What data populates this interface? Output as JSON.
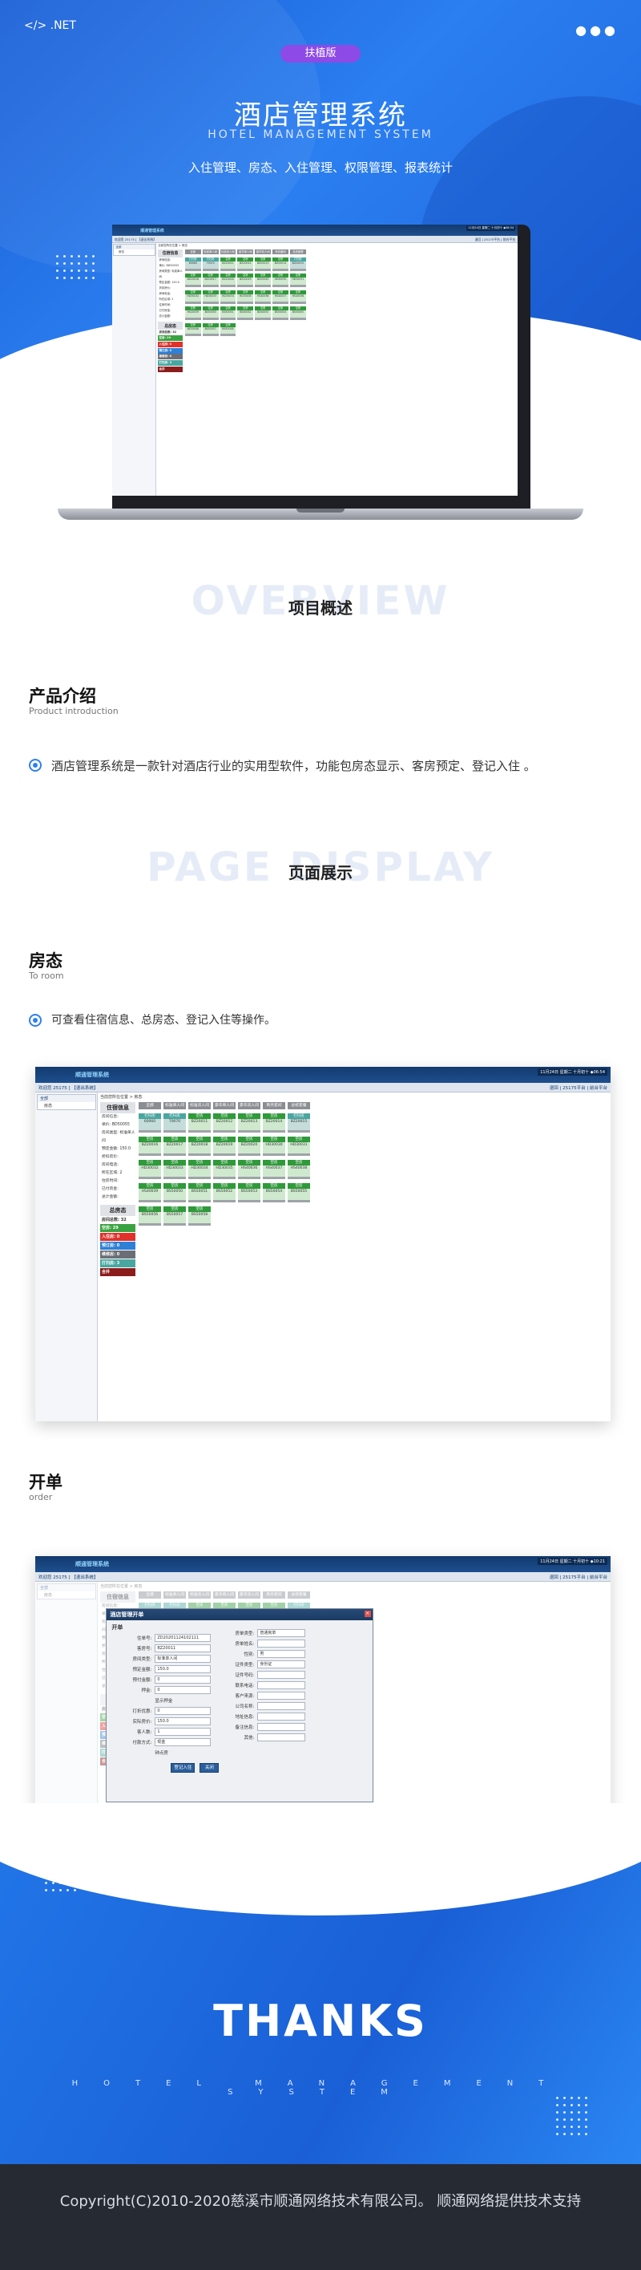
{
  "hero": {
    "logo": "</> .NET",
    "edition_badge": "扶植版",
    "title": "酒店管理系统",
    "subtitle": "HOTEL MANAGEMENT SYSTEM",
    "features": "入住管理、房态、入住管理、权限管理、报表统计"
  },
  "overview": {
    "ghost": "OVERVIEW",
    "title": "项目概述"
  },
  "intro": {
    "title": "产品介绍",
    "subtitle": "Product introduction",
    "text": "酒店管理系统是一款针对酒店行业的实用型软件，功能包房态显示、客房预定、登记入住 。"
  },
  "display": {
    "ghost": "PAGE DISPLAY",
    "title": "页面展示"
  },
  "room_status": {
    "title": "房态",
    "subtitle": "To room",
    "text": "可查看住宿信息、总房态、登记入住等操作。"
  },
  "order": {
    "title": "开单",
    "subtitle": "order"
  },
  "app": {
    "logo": "顺通管理系统",
    "clock": "11月24日 星期二 十月初十 ◆06:54",
    "clock2": "11月24日 星期二 十月初十 ◆10:21",
    "welcome": "欢迎您 25175 [ 【退出系统】",
    "links": "退回 | 25175平台 | 前台平台",
    "tree_head": "全部",
    "tree_item": "房态",
    "crumb": "当前您所在位置 > 房态",
    "info_title": "住宿信息",
    "info_lines": [
      "房间信息:",
      "单价: BD50055",
      "房间类型: 标准单人间",
      "预定金额: 150.0",
      "折扣房价:",
      "房间电话:",
      "所在区域: 2",
      "住房时间:",
      "已付房金:",
      "总计金额:"
    ],
    "total_title": "总房态",
    "total_rooms": "房间总数: 32",
    "stats": [
      {
        "label": "空房: 29",
        "color": "#3aa341"
      },
      {
        "label": "入住房: 0",
        "color": "#e0312b"
      },
      {
        "label": "预订房: 0",
        "color": "#2e7fd6"
      },
      {
        "label": "维修房: 0",
        "color": "#6b6f75"
      },
      {
        "label": "打扫房: 3",
        "color": "#4aa6a0"
      },
      {
        "label": "合并",
        "color": "#8b1d1d"
      }
    ],
    "tabs": [
      "全部",
      "标准单人间",
      "标准双人间",
      "豪华单人间",
      "豪华双人间",
      "商务套间",
      "总统套餐"
    ],
    "room_rows": [
      [
        {
          "s": "打扫房",
          "n": "60060",
          "b": true
        },
        {
          "s": "打扫房",
          "n": "70070",
          "b": true
        },
        {
          "s": "空房",
          "n": "BZ20011"
        },
        {
          "s": "空房",
          "n": "BZ20012"
        },
        {
          "s": "空房",
          "n": "BZ20013"
        },
        {
          "s": "空房",
          "n": "BZ20014"
        },
        {
          "s": "打扫房",
          "n": "BZ20015",
          "b": true
        }
      ],
      [
        {
          "s": "空房",
          "n": "BZ20016"
        },
        {
          "s": "空房",
          "n": "BZ20017"
        },
        {
          "s": "空房",
          "n": "BZ20018"
        },
        {
          "s": "空房",
          "n": "BZ20019"
        },
        {
          "s": "空房",
          "n": "BZ20020"
        },
        {
          "s": "空房",
          "n": "HD30030"
        },
        {
          "s": "空房",
          "n": "HD30031"
        }
      ],
      [
        {
          "s": "空房",
          "n": "HD30032"
        },
        {
          "s": "空房",
          "n": "HD30033"
        },
        {
          "s": "空房",
          "n": "HD30034"
        },
        {
          "s": "空房",
          "n": "HD30035"
        },
        {
          "s": "空房",
          "n": "HS40036"
        },
        {
          "s": "空房",
          "n": "HS40037"
        },
        {
          "s": "空房",
          "n": "HS40038"
        }
      ],
      [
        {
          "s": "空房",
          "n": "HS40039"
        },
        {
          "s": "空房",
          "n": "BS50050"
        },
        {
          "s": "空房",
          "n": "BS50051"
        },
        {
          "s": "空房",
          "n": "BS50052"
        },
        {
          "s": "空房",
          "n": "BS50053"
        },
        {
          "s": "空房",
          "n": "BS50054"
        },
        {
          "s": "空房",
          "n": "BS50055"
        }
      ],
      [
        {
          "s": "空房",
          "n": "BS50056"
        },
        {
          "s": "空房",
          "n": "BS50057"
        },
        {
          "s": "空房",
          "n": "BS50058"
        }
      ]
    ],
    "modal": {
      "title": "酒店管理开单",
      "section": "开单",
      "left_rows": [
        {
          "label": "住单号:",
          "value": "ZD20201124102111"
        },
        {
          "label": "客房号:",
          "value": "BZ20011"
        },
        {
          "label": "房间类型:",
          "value": "标准单人间"
        },
        {
          "label": "预定金额:",
          "value": "150.0"
        },
        {
          "label": "预付金额:",
          "value": "0"
        },
        {
          "label": "押金:",
          "value": "0"
        },
        {
          "label": "",
          "value": "显示押金"
        },
        {
          "label": "打折优惠:",
          "value": "0"
        },
        {
          "label": "实际房价:",
          "value": "150.0"
        },
        {
          "label": "客人数:",
          "value": "1"
        },
        {
          "label": "付款方式:",
          "value": "现金"
        },
        {
          "label": "",
          "value": "钟点房"
        }
      ],
      "right_rows": [
        {
          "label": "房单类型:",
          "value": "普通房单"
        },
        {
          "label": "房单姓名:",
          "value": ""
        },
        {
          "label": "性别:",
          "value": "男"
        },
        {
          "label": "证件类型:",
          "value": "身份证"
        },
        {
          "label": "证件号码:",
          "value": ""
        },
        {
          "label": "联系电话:",
          "value": ""
        },
        {
          "label": "客户来源:",
          "value": ""
        },
        {
          "label": "公司名称:",
          "value": ""
        },
        {
          "label": "地址信息:",
          "value": ""
        },
        {
          "label": "备注信息:",
          "value": ""
        },
        {
          "label": "其他:",
          "value": ""
        }
      ],
      "confirm": "登记入住",
      "cancel": "关闭"
    }
  },
  "thanks": {
    "title": "THANKS",
    "subtitle": "HOTEL MANAGEMENT SYSTEM"
  },
  "footer": {
    "text": "Copyright(C)2010-2020慈溪市顺通网络技术有限公司。 顺通网络提供技术支持"
  }
}
